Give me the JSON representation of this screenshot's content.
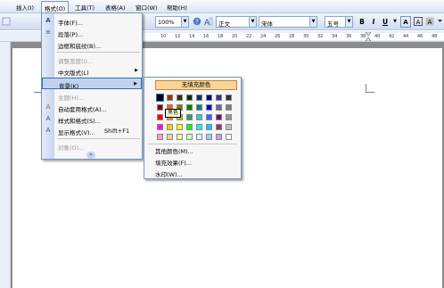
{
  "menubar": {
    "items": [
      "插入(I)",
      "格式(O)",
      "工具(T)",
      "表格(A)",
      "窗口(W)",
      "帮助(H)"
    ]
  },
  "toolbar": {
    "zoom": "100%",
    "style": "正文",
    "font": "宋体",
    "size": "五号",
    "bold": "B",
    "italic": "I",
    "underline": "U",
    "font_color": "A"
  },
  "ruler": {
    "numbers": [
      "10",
      "12",
      "14",
      "16",
      "18",
      "20",
      "22",
      "24",
      "26",
      "28",
      "30",
      "32",
      "34",
      "36",
      "38",
      "40",
      "42",
      "44",
      "46",
      "48"
    ]
  },
  "format_menu": {
    "items": [
      {
        "label": "字体(F)...",
        "icon": "A"
      },
      {
        "label": "段落(P)...",
        "icon": "≡"
      },
      {
        "label": "边框和底纹(B)..."
      },
      {
        "label": "调整宽度(I)..."
      },
      {
        "label": "中文版式(L)",
        "submenu": "▶"
      },
      {
        "label": "背景(K)",
        "submenu": "▶"
      },
      {
        "label": "主题(H)..."
      },
      {
        "label": "自动套用格式(A)...",
        "icon": "A"
      },
      {
        "label": "样式和格式(S)...",
        "icon": "A"
      },
      {
        "label": "显示格式(V)...",
        "shortcut": "Shift+F1",
        "icon": "A"
      },
      {
        "label": "对象(O)..."
      }
    ],
    "expand": "»"
  },
  "background_menu": {
    "no_fill": "无填充颜色",
    "tooltip": "黑色",
    "more_colors": "其他颜色(M)...",
    "fill_effects": "填充效果(F)...",
    "watermark": "水印(W)...",
    "colors": [
      [
        "#000000",
        "#993300",
        "#333300",
        "#003300",
        "#003366",
        "#000080",
        "#333399",
        "#333333"
      ],
      [
        "#800000",
        "#ff6600",
        "#808000",
        "#008000",
        "#008080",
        "#0000ff",
        "#666699",
        "#808080"
      ],
      [
        "#ff0000",
        "#ff9900",
        "#99cc00",
        "#339966",
        "#33cccc",
        "#3366ff",
        "#800080",
        "#969696"
      ],
      [
        "#ff00ff",
        "#ffcc00",
        "#ffff00",
        "#00ff00",
        "#00ffff",
        "#00ccff",
        "#993366",
        "#c0c0c0"
      ],
      [
        "#ff99cc",
        "#ffcc99",
        "#ffff99",
        "#ccffcc",
        "#ccffff",
        "#99ccff",
        "#cc99ff",
        "#ffffff"
      ]
    ]
  }
}
